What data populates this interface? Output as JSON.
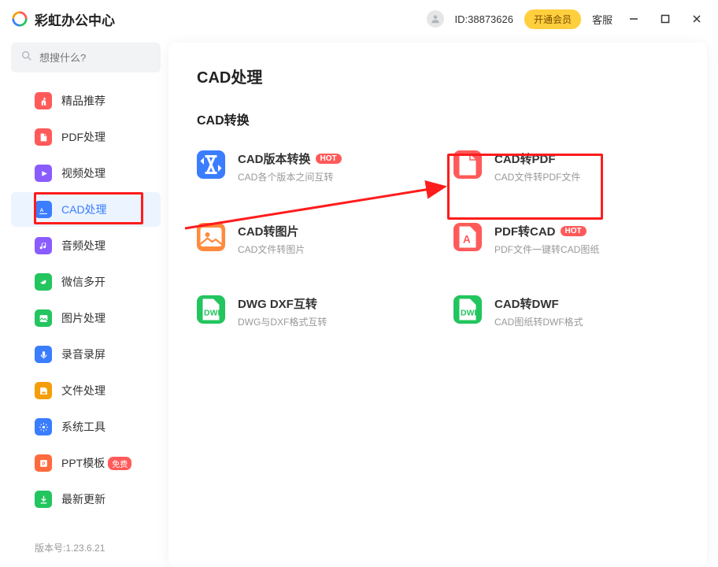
{
  "titlebar": {
    "app_name": "彩虹办公中心",
    "user_id": "ID:38873626",
    "vip_btn": "开通会员",
    "kefu": "客服"
  },
  "search": {
    "placeholder": "想搜什么?"
  },
  "sidebar": {
    "items": [
      {
        "label": "精品推荐",
        "bg": "#ff5a5a"
      },
      {
        "label": "PDF处理",
        "bg": "#ff5a5a"
      },
      {
        "label": "视频处理",
        "bg": "#8a5cff"
      },
      {
        "label": "CAD处理",
        "bg": "#3a7dff",
        "active": true
      },
      {
        "label": "音频处理",
        "bg": "#8a5cff"
      },
      {
        "label": "微信多开",
        "bg": "#22c55e"
      },
      {
        "label": "图片处理",
        "bg": "#22c55e"
      },
      {
        "label": "录音录屏",
        "bg": "#3a7dff"
      },
      {
        "label": "文件处理",
        "bg": "#f59e0b"
      },
      {
        "label": "系统工具",
        "bg": "#3a7dff"
      },
      {
        "label": "PPT模板",
        "bg": "#ff6a3d",
        "badge": "免费"
      },
      {
        "label": "最新更新",
        "bg": "#22c55e"
      }
    ]
  },
  "version": "版本号:1.23.6.21",
  "main": {
    "page_title": "CAD处理",
    "section_title": "CAD转换",
    "cards": [
      {
        "title": "CAD版本转换",
        "desc": "CAD各个版本之间互转",
        "hot": true,
        "color": "#3a7dff"
      },
      {
        "title": "CAD转PDF",
        "desc": "CAD文件转PDF文件",
        "hot": false,
        "color": "#ff5a5a"
      },
      {
        "title": "CAD转图片",
        "desc": "CAD文件转图片",
        "hot": false,
        "color": "#ff8a3d"
      },
      {
        "title": "PDF转CAD",
        "desc": "PDF文件一键转CAD图纸",
        "hot": true,
        "color": "#ff5a5a"
      },
      {
        "title": "DWG DXF互转",
        "desc": "DWG与DXF格式互转",
        "hot": false,
        "color": "#22c55e"
      },
      {
        "title": "CAD转DWF",
        "desc": "CAD图纸转DWF格式",
        "hot": false,
        "color": "#22c55e"
      }
    ],
    "hot_label": "HOT"
  }
}
